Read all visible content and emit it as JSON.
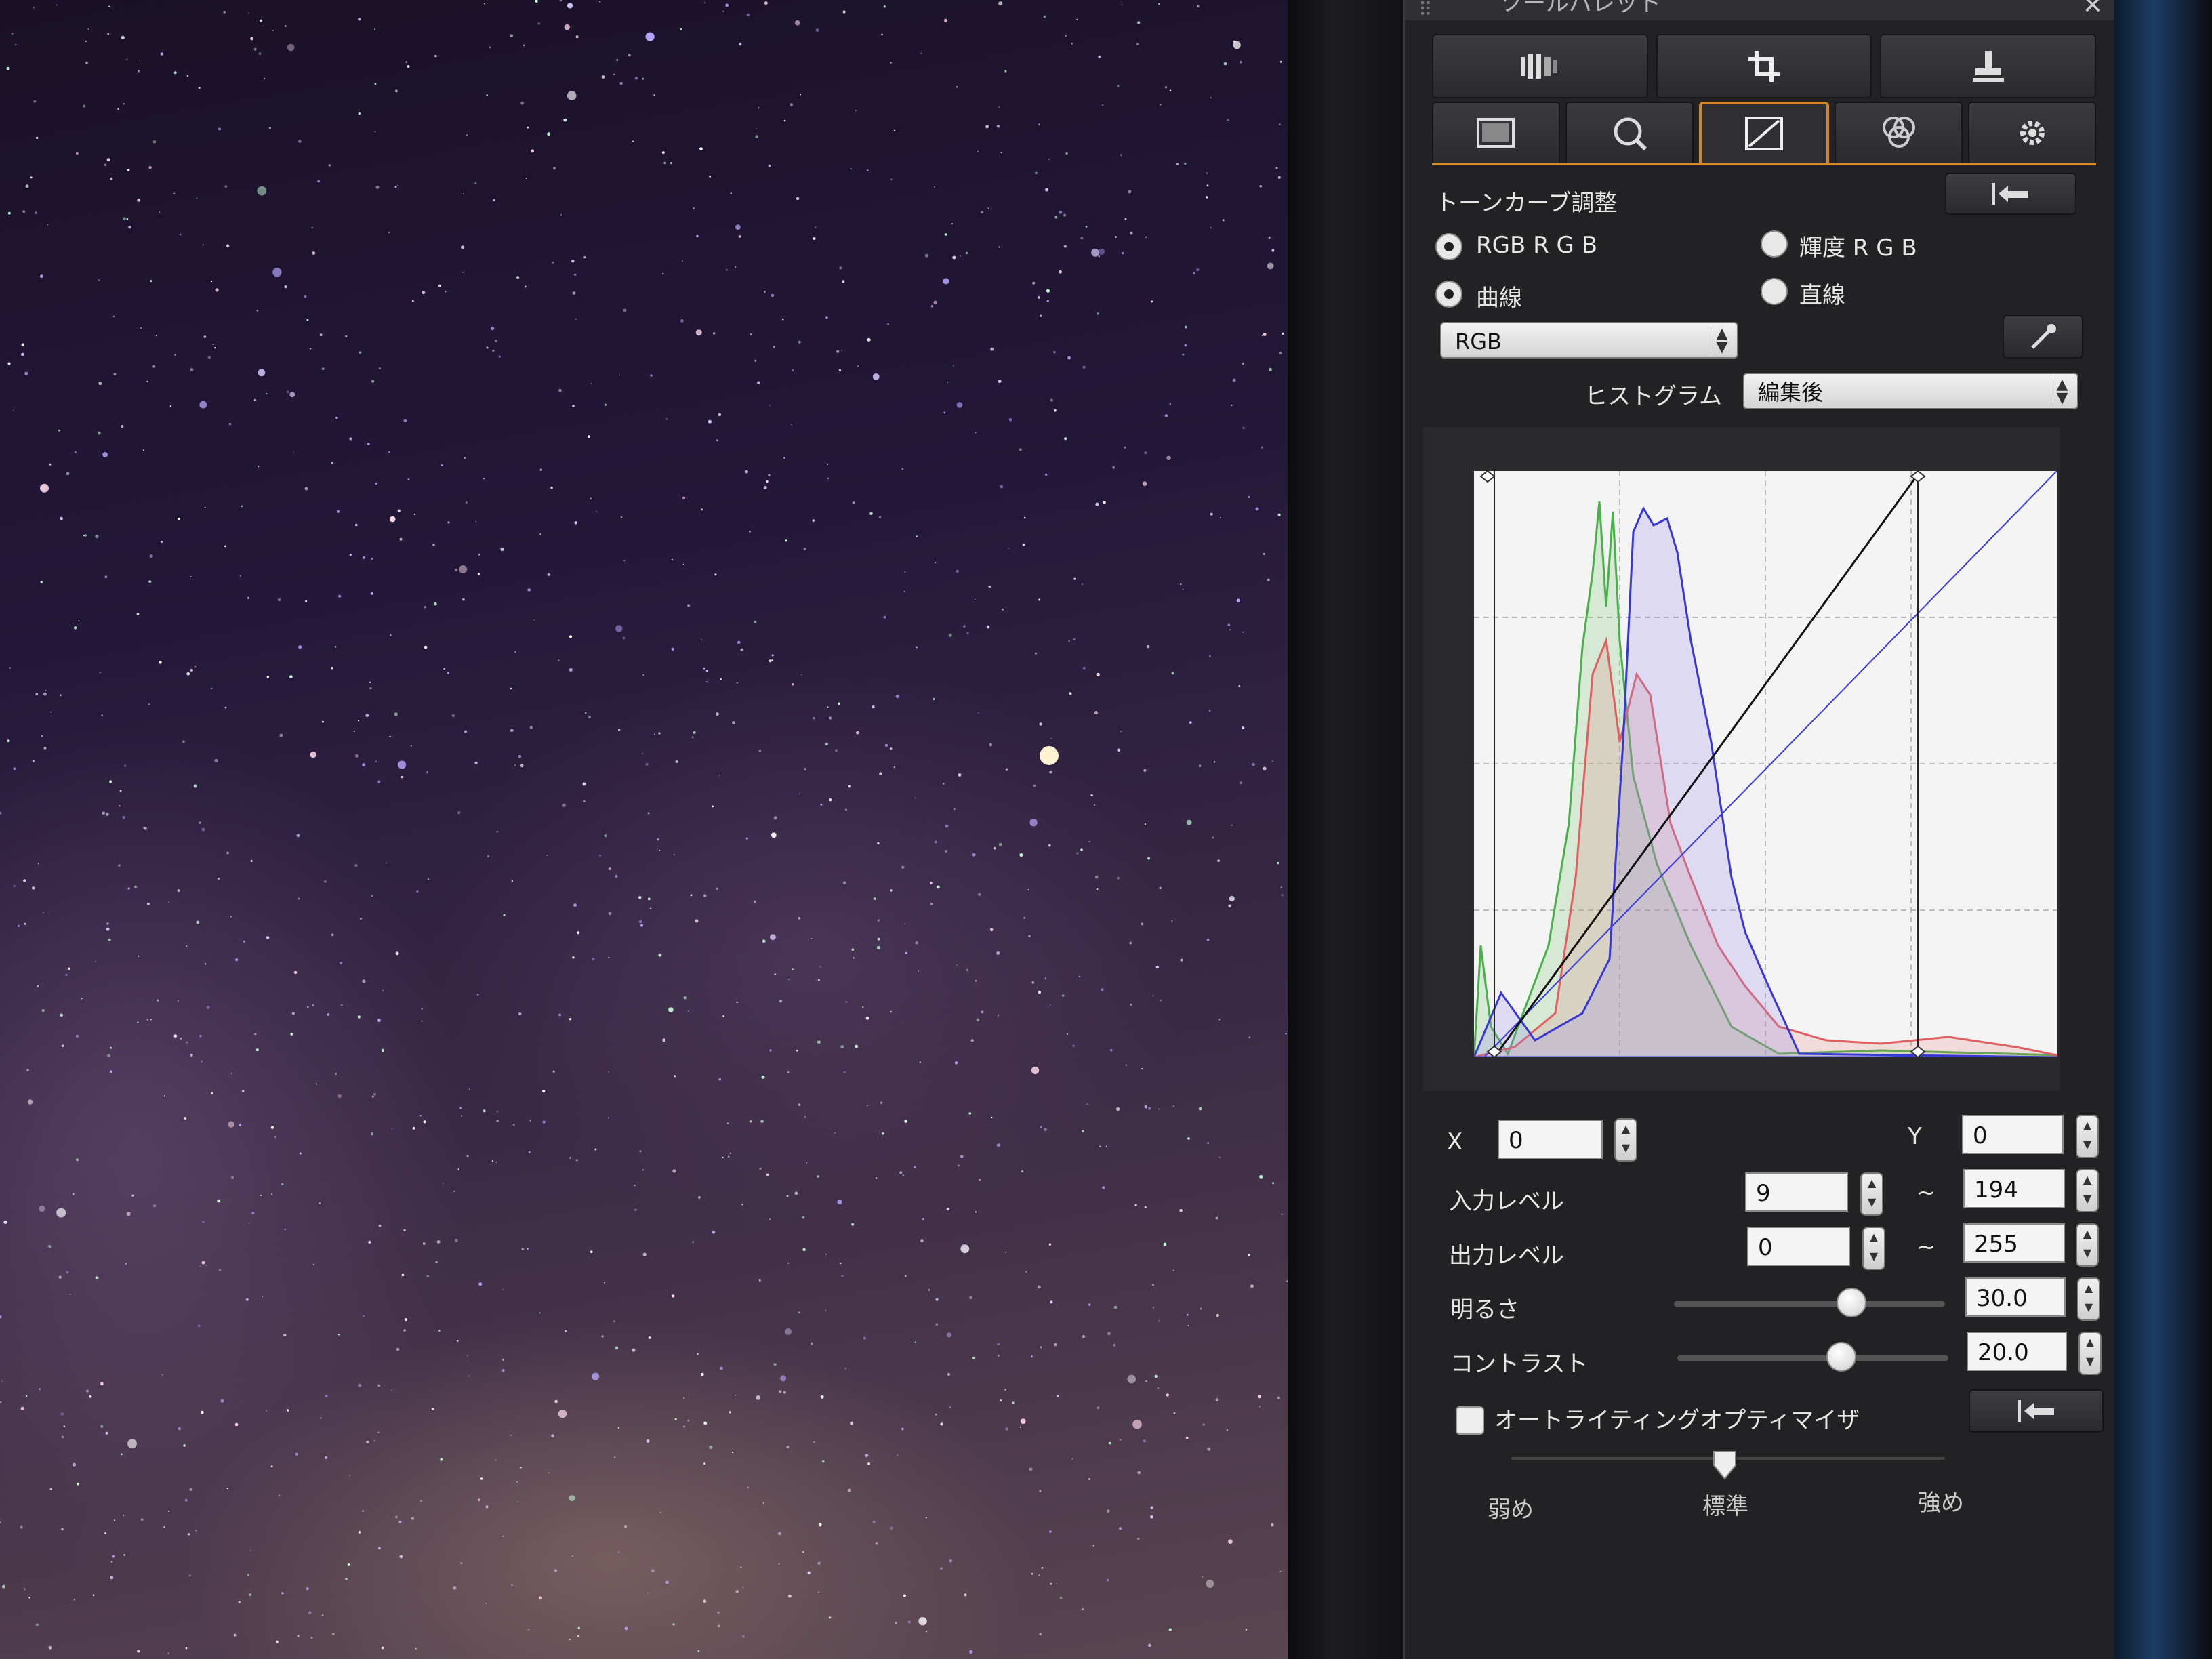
{
  "panel": {
    "title": "ツールパレット",
    "close_symbol": "✕",
    "toolbar_icons": [
      "tool-palette-icon",
      "crop-icon",
      "stamp-icon"
    ],
    "tab_icons": [
      "picture-style-icon",
      "lens-correction-icon",
      "tone-curve-icon",
      "color-adjust-icon",
      "settings-icon"
    ],
    "active_tab": 2
  },
  "tone_curve": {
    "heading": "トーンカーブ調整",
    "reset_icon": "undo-arrow-icon",
    "mode_rgb_label": "RGB R G B",
    "mode_luminance_label": "輝度 R G B",
    "curve_label": "曲線",
    "linear_label": "直線",
    "mode_rgb_selected": true,
    "curve_selected": true,
    "channel_select": "RGB",
    "histogram_label": "ヒストグラム",
    "histogram_select": "編集後",
    "eyedropper_icon": "eyedropper-icon"
  },
  "fields": {
    "x_label": "X",
    "x_value": "0",
    "y_label": "Y",
    "y_value": "0",
    "input_level_label": "入力レベル",
    "input_level_min": "9",
    "input_level_max": "194",
    "output_level_label": "出力レベル",
    "output_level_min": "0",
    "output_level_max": "255",
    "tilde": "~",
    "brightness_label": "明るさ",
    "brightness_value": "30.0",
    "contrast_label": "コントラスト",
    "contrast_value": "20.0"
  },
  "alo": {
    "label": "オートライティングオプティマイザ",
    "checked": false,
    "low_label": "弱め",
    "standard_label": "標準",
    "high_label": "強め"
  }
}
